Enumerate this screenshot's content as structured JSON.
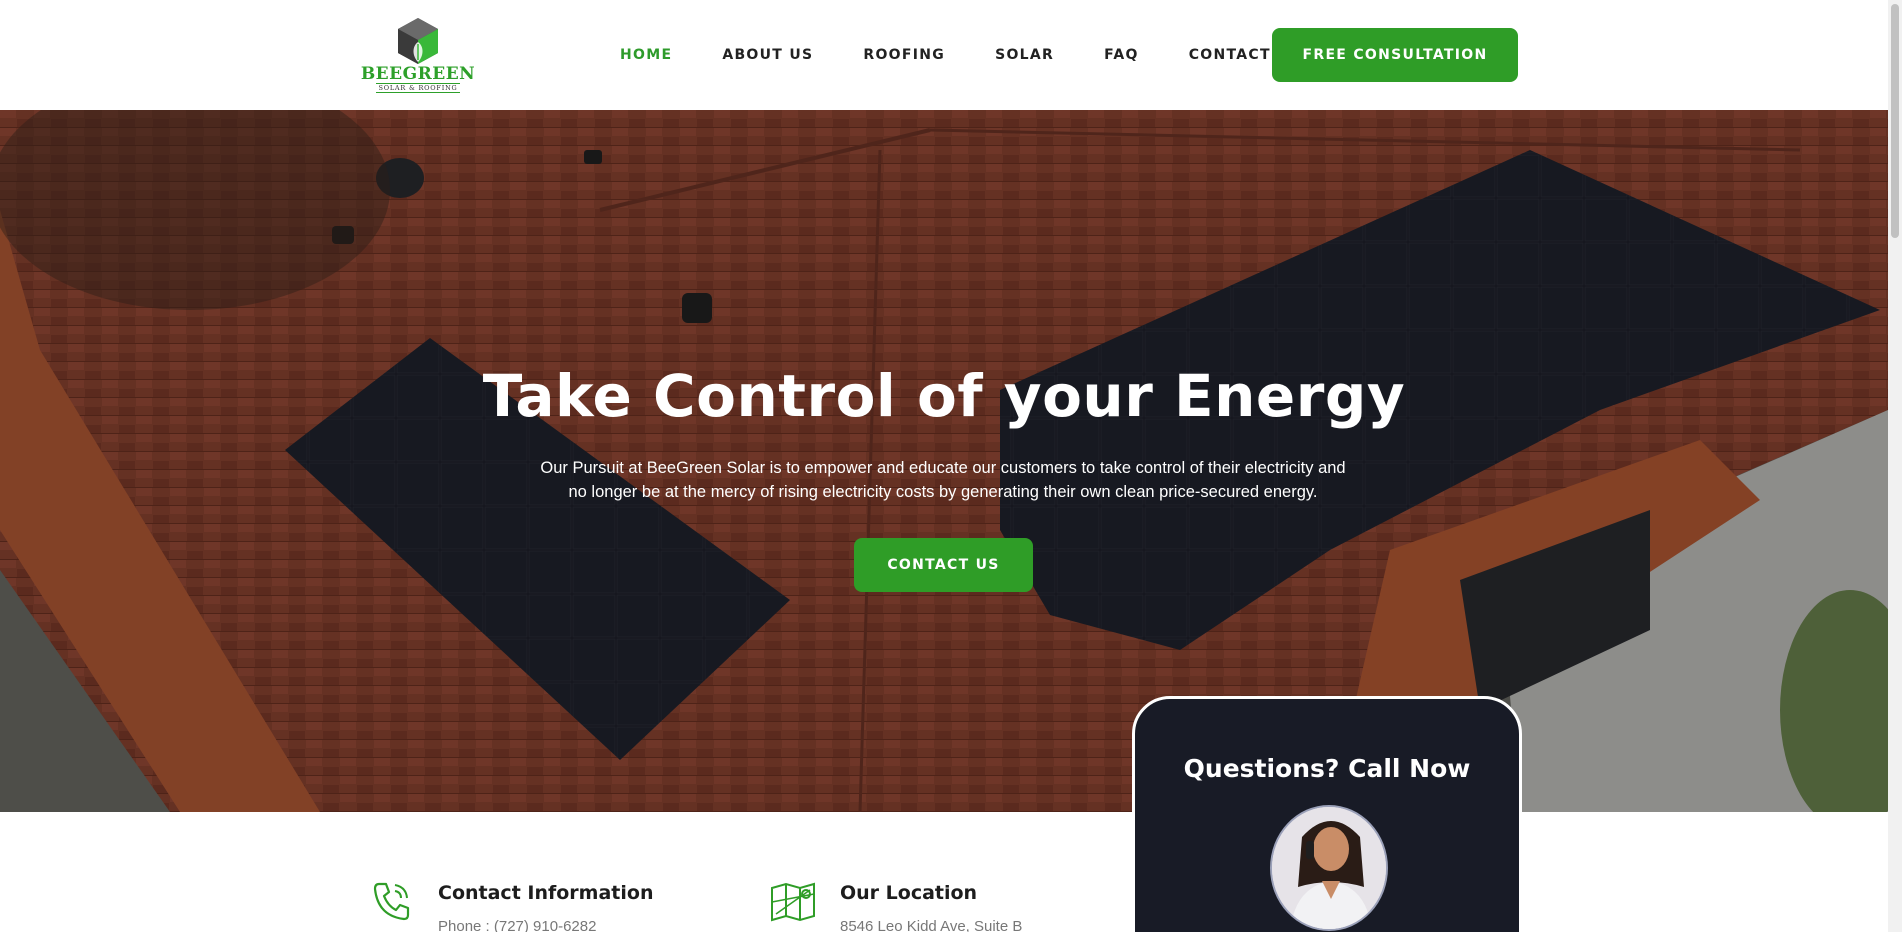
{
  "brand": {
    "name": "BEEGREEN",
    "tagline": "SOLAR & ROOFING",
    "colors": {
      "green": "#2f9d27",
      "dark": "#181b26",
      "roof": "#8c4431"
    }
  },
  "nav": {
    "items": [
      {
        "label": "HOME",
        "active": true
      },
      {
        "label": "ABOUT US"
      },
      {
        "label": "ROOFING"
      },
      {
        "label": "SOLAR"
      },
      {
        "label": "FAQ"
      },
      {
        "label": "CONTACT US"
      }
    ],
    "cta_label": "FREE CONSULTATION"
  },
  "hero": {
    "title": "Take Control of your Energy",
    "description": "Our Pursuit at BeeGreen Solar is to empower and educate our customers to take control of their electricity and no longer be at the mercy of rising electricity costs by generating their own clean price-secured energy.",
    "button_label": "CONTACT US"
  },
  "call_card": {
    "title": "Questions? Call Now"
  },
  "info": {
    "contact": {
      "icon": "phone-icon",
      "title": "Contact Information",
      "text": "Phone : (727) 910-6282"
    },
    "location": {
      "icon": "map-icon",
      "title": "Our Location",
      "text": "8546 Leo Kidd Ave, Suite B"
    }
  }
}
